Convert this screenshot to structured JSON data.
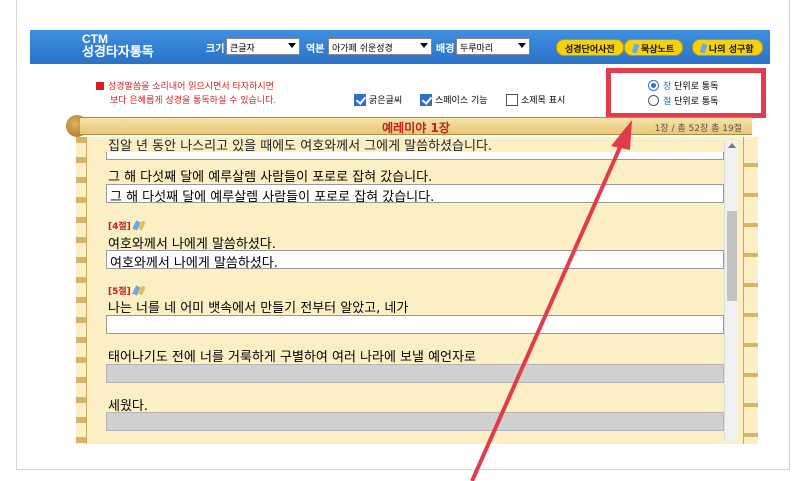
{
  "header": {
    "brand_top": "CTM",
    "brand_bottom": "성경타자통독",
    "size_label": "크기",
    "size_value": "큰글자",
    "version_label": "역본",
    "version_value": "아가페 쉬운성경",
    "bg_label": "배경",
    "bg_value": "두루마리",
    "btn_dictionary": "성경단어사전",
    "btn_notes": "묵상노트",
    "btn_my_verses": "나의 성구함"
  },
  "notice": {
    "line1": "성경말씀을 소리내어 읽으시면서 타자하시면",
    "line2": "보다 은혜롭게 성경을 통독하실 수 있습니다."
  },
  "options": {
    "bold_label": "굵은글씨",
    "space_label": "스페이스 기능",
    "subtitle_label": "소제목 표시"
  },
  "mode": {
    "chapter_key": "장",
    "chapter_rest": " 단위로 통독",
    "verse_key": "절",
    "verse_rest": " 단위로 통독"
  },
  "chapter": {
    "title": "예레미야 1장",
    "info": "1장 / 총 52장   총 19절"
  },
  "verses": {
    "cut_line": "집알 년 동안 나스리고 있을 때에도 여호와께서 그에게 말씀하셨습니다.",
    "v3_text": "그 해 다섯째 달에 예루살렘 사람들이 포로로 잡혀 갔습니다.",
    "v3_typed": "그 해 다섯째 달에 예루살렘 사람들이 포로로 잡혀 갔습니다.",
    "v4_num": "[4절]",
    "v4_text": "여호와께서 나에게 말씀하셨다.",
    "v4_typed": "여호와께서 나에게 말씀하셨다.",
    "v5_num": "[5절]",
    "v5_text1": "나는 너를 네 어미 뱃속에서 만들기 전부터 알았고, 네가",
    "v5_text2": "태어나기도 전에 너를 거룩하게 구별하여 여러 나라에 보낼 예언자로",
    "v5_text3": "세웠다."
  }
}
